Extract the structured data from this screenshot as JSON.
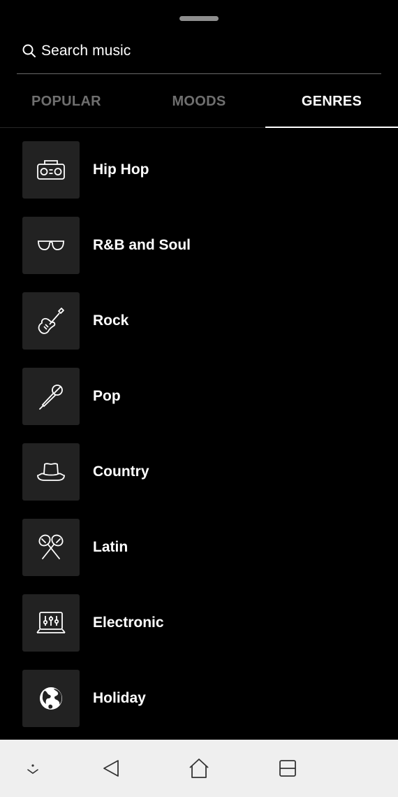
{
  "search": {
    "placeholder": "Search music"
  },
  "tabs": [
    {
      "label": "POPULAR",
      "active": false
    },
    {
      "label": "MOODS",
      "active": false
    },
    {
      "label": "GENRES",
      "active": true
    }
  ],
  "genres": [
    {
      "label": "Hip Hop",
      "icon": "boombox-icon"
    },
    {
      "label": "R&B and Soul",
      "icon": "sunglasses-icon"
    },
    {
      "label": "Rock",
      "icon": "electric-guitar-icon"
    },
    {
      "label": "Pop",
      "icon": "microphone-icon"
    },
    {
      "label": "Country",
      "icon": "cowboy-hat-icon"
    },
    {
      "label": "Latin",
      "icon": "maracas-icon"
    },
    {
      "label": "Electronic",
      "icon": "mixer-laptop-icon"
    },
    {
      "label": "Holiday",
      "icon": "globe-icon"
    }
  ],
  "navbar": {
    "buttons": [
      "notification-dot-icon",
      "back-icon",
      "home-icon",
      "recents-icon"
    ]
  },
  "colors": {
    "background": "#000000",
    "tile": "#222222",
    "inactive_tab": "#6f6f6f",
    "navbar": "#efefef"
  }
}
